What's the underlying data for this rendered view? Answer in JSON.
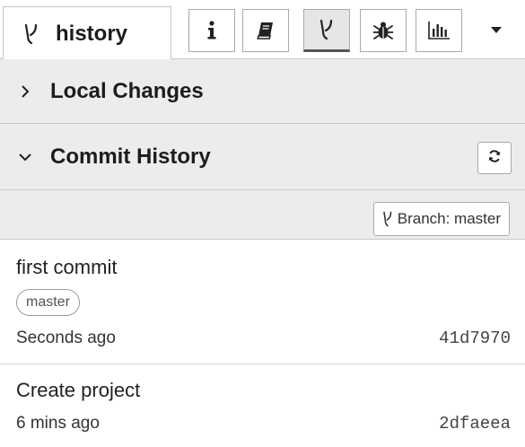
{
  "tab": {
    "label": "history",
    "icon": "branch-icon"
  },
  "toolbar": {
    "buttons": [
      {
        "icon": "info-icon",
        "selected": false
      },
      {
        "icon": "book-icon",
        "selected": false
      },
      {
        "icon": "branch-icon",
        "selected": true
      },
      {
        "icon": "bug-icon",
        "selected": false
      },
      {
        "icon": "bar-chart-icon",
        "selected": false
      }
    ],
    "menu_icon": "caret-down-icon"
  },
  "sections": {
    "local_changes": {
      "title": "Local Changes",
      "expanded": false,
      "icon": "chevron-right-icon"
    },
    "commit_history": {
      "title": "Commit History",
      "expanded": true,
      "icon": "chevron-down-icon",
      "refresh_icon": "refresh-icon"
    }
  },
  "branch_selector": {
    "label": "Branch: master",
    "icon": "branch-icon"
  },
  "commits": [
    {
      "message": "first commit",
      "badge": "master",
      "time": "Seconds ago",
      "sha": "41d7970"
    },
    {
      "message": "Create project",
      "time": "6 mins ago",
      "sha": "2dfaeea"
    }
  ],
  "colors": {
    "header_bg": "#ececec",
    "border": "#c9c9c9",
    "text": "#222222",
    "selected_btn_bg": "#e6e6e6"
  }
}
